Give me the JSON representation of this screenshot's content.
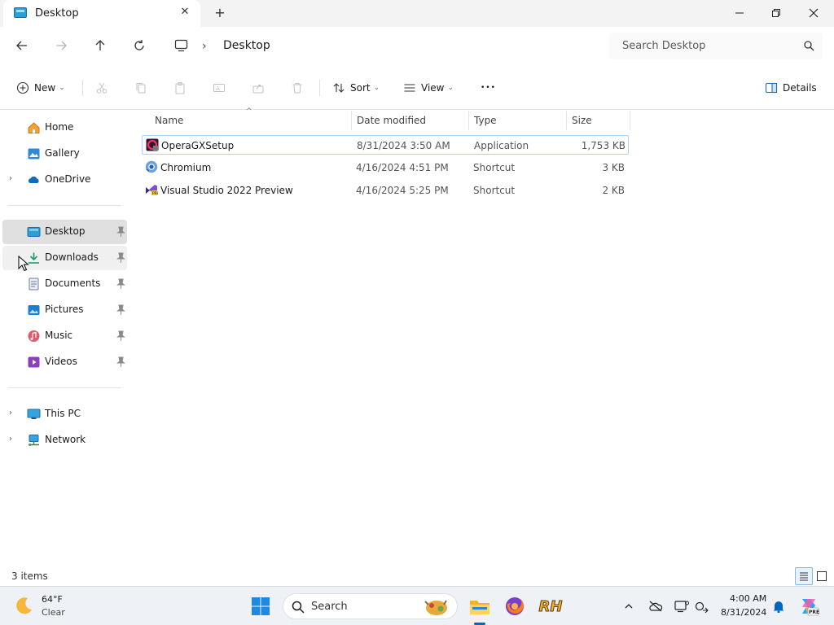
{
  "window": {
    "tab_title": "Desktop",
    "tab_close_glyph": "✕",
    "new_tab_glyph": "+",
    "icons": {
      "tab": "desktop-folder-icon"
    }
  },
  "address": {
    "path_root_icon": "this-pc-icon",
    "separator": "›",
    "current": "Desktop",
    "search_placeholder": "Search Desktop"
  },
  "commands": {
    "new_label": "New",
    "sort_label": "Sort",
    "view_label": "View",
    "details_label": "Details",
    "more_glyph": "•••",
    "chevron_glyph": "⌄"
  },
  "sidebar": {
    "expand_glyph": "›",
    "items": [
      {
        "label": "Home",
        "icon": "home-icon"
      },
      {
        "label": "Gallery",
        "icon": "gallery-icon"
      },
      {
        "label": "OneDrive",
        "icon": "onedrive-icon"
      },
      {
        "label": "Desktop",
        "icon": "desktop-folder-icon"
      },
      {
        "label": "Downloads",
        "icon": "downloads-icon"
      },
      {
        "label": "Documents",
        "icon": "documents-icon"
      },
      {
        "label": "Pictures",
        "icon": "pictures-icon"
      },
      {
        "label": "Music",
        "icon": "music-icon"
      },
      {
        "label": "Videos",
        "icon": "videos-icon"
      },
      {
        "label": "This PC",
        "icon": "this-pc-icon"
      },
      {
        "label": "Network",
        "icon": "network-icon"
      }
    ]
  },
  "filelist": {
    "columns": {
      "name": "Name",
      "date": "Date modified",
      "type": "Type",
      "size": "Size"
    },
    "sort_glyph": "^",
    "rows": [
      {
        "name": "OperaGXSetup",
        "date": "8/31/2024 3:50 AM",
        "type": "Application",
        "size": "1,753 KB",
        "icon": "opera-gx-icon"
      },
      {
        "name": "Chromium",
        "date": "4/16/2024 4:51 PM",
        "type": "Shortcut",
        "size": "3 KB",
        "icon": "chromium-icon"
      },
      {
        "name": "Visual Studio 2022 Preview",
        "date": "4/16/2024 5:25 PM",
        "type": "Shortcut",
        "size": "2 KB",
        "icon": "visual-studio-icon"
      }
    ]
  },
  "statusbar": {
    "item_count": "3 items"
  },
  "taskbar": {
    "weather_temp": "64°F",
    "weather_cond": "Clear",
    "search_label": "Search",
    "time": "4:00 AM",
    "date": "8/31/2024",
    "rh_label": "RH",
    "copilot_badge": "PRE"
  },
  "colors": {
    "accent": "#0067c0",
    "selection_border": "#a9d2f5",
    "nav_selected": "#e0e0e0"
  }
}
